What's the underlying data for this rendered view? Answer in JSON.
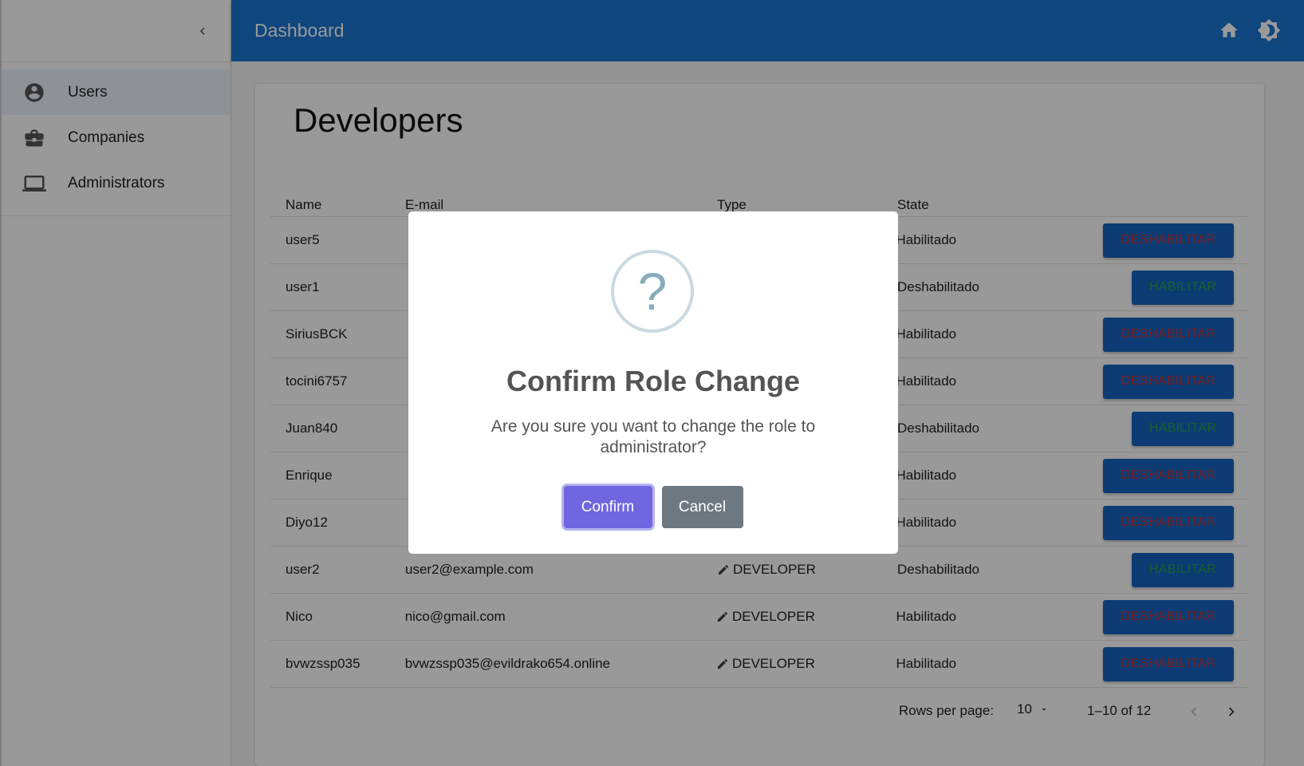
{
  "sidebar": {
    "collapse_icon": "chevron-left-icon",
    "items": [
      {
        "label": "Users",
        "icon": "account-circle-icon",
        "active": true
      },
      {
        "label": "Companies",
        "icon": "briefcase-icon",
        "active": false
      },
      {
        "label": "Administrators",
        "icon": "laptop-icon",
        "active": false
      }
    ]
  },
  "appbar": {
    "title": "Dashboard",
    "icons": [
      "home-icon",
      "brightness-icon"
    ],
    "color": "#1976d2"
  },
  "page": {
    "title": "Developers"
  },
  "table": {
    "headers": {
      "name": "Name",
      "email": "E-mail",
      "type": "Type",
      "state": "State"
    },
    "rows": [
      {
        "name": "user5",
        "email": "",
        "type": "",
        "state": "Habilitado",
        "action": "DESHABILITAR"
      },
      {
        "name": "user1",
        "email": "",
        "type": "",
        "state": "Deshabilitado",
        "action": "HABILITAR"
      },
      {
        "name": "SiriusBCK",
        "email": "",
        "type": "",
        "state": "Habilitado",
        "action": "DESHABILITAR"
      },
      {
        "name": "tocini6757",
        "email": "",
        "type": "",
        "state": "Habilitado",
        "action": "DESHABILITAR"
      },
      {
        "name": "Juan840",
        "email": "",
        "type": "",
        "state": "Deshabilitado",
        "action": "HABILITAR"
      },
      {
        "name": "Enrique",
        "email": "",
        "type": "",
        "state": "Habilitado",
        "action": "DESHABILITAR"
      },
      {
        "name": "Diyo12",
        "email": "",
        "type": "",
        "state": "Habilitado",
        "action": "DESHABILITAR"
      },
      {
        "name": "user2",
        "email": "user2@example.com",
        "type": "DEVELOPER",
        "state": "Deshabilitado",
        "action": "HABILITAR"
      },
      {
        "name": "Nico",
        "email": "nico@gmail.com",
        "type": "DEVELOPER",
        "state": "Habilitado",
        "action": "DESHABILITAR"
      },
      {
        "name": "bvwzssp035",
        "email": "bvwzssp035@evildrako654.online",
        "type": "DEVELOPER",
        "state": "Habilitado",
        "action": "DESHABILITAR"
      }
    ]
  },
  "pagination": {
    "rows_per_page_label": "Rows per page:",
    "rows_per_page_value": "10",
    "range": "1–10 of 12"
  },
  "modal": {
    "icon_glyph": "?",
    "title": "Confirm Role Change",
    "message": "Are you sure you want to change the role to administrator?",
    "confirm_label": "Confirm",
    "cancel_label": "Cancel",
    "confirm_color": "#7066e0",
    "cancel_color": "#6e7881"
  }
}
